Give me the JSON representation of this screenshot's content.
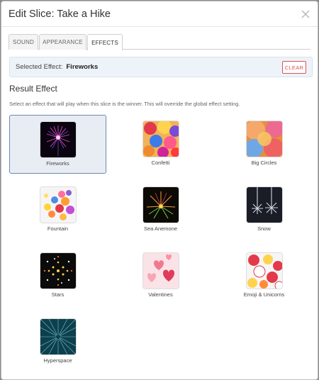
{
  "modal": {
    "title": "Edit Slice: Take a Hike"
  },
  "tabs": [
    {
      "label": "SOUND",
      "active": false
    },
    {
      "label": "APPEARANCE",
      "active": false
    },
    {
      "label": "EFFECTS",
      "active": true
    }
  ],
  "selected_effect": {
    "label": "Selected Effect:",
    "value": "Fireworks",
    "clear_label": "CLEAR"
  },
  "result_effect": {
    "title": "Result Effect",
    "description": "Select an effect that will play when this slice is the winner. This will override the global effect setting."
  },
  "effects": [
    {
      "label": "Fireworks",
      "icon": "fireworks-thumbnail",
      "selected": true
    },
    {
      "label": "Confetti",
      "icon": "confetti-thumbnail",
      "selected": false
    },
    {
      "label": "Big Circles",
      "icon": "big-circles-thumbnail",
      "selected": false
    },
    {
      "label": "Fountain",
      "icon": "fountain-thumbnail",
      "selected": false
    },
    {
      "label": "Sea Anemone",
      "icon": "sea-anemone-thumbnail",
      "selected": false
    },
    {
      "label": "Snow",
      "icon": "snow-thumbnail",
      "selected": false
    },
    {
      "label": "Stars",
      "icon": "stars-thumbnail",
      "selected": false
    },
    {
      "label": "Valentines",
      "icon": "valentines-thumbnail",
      "selected": false
    },
    {
      "label": "Emoji & Unicorns",
      "icon": "emoji-unicorns-thumbnail",
      "selected": false
    },
    {
      "label": "Hyperspace",
      "icon": "hyperspace-thumbnail",
      "selected": false
    }
  ],
  "colors": {
    "accent": "#6c88b3",
    "danger": "#d9534f",
    "selected_bg": "#e8edf4"
  }
}
